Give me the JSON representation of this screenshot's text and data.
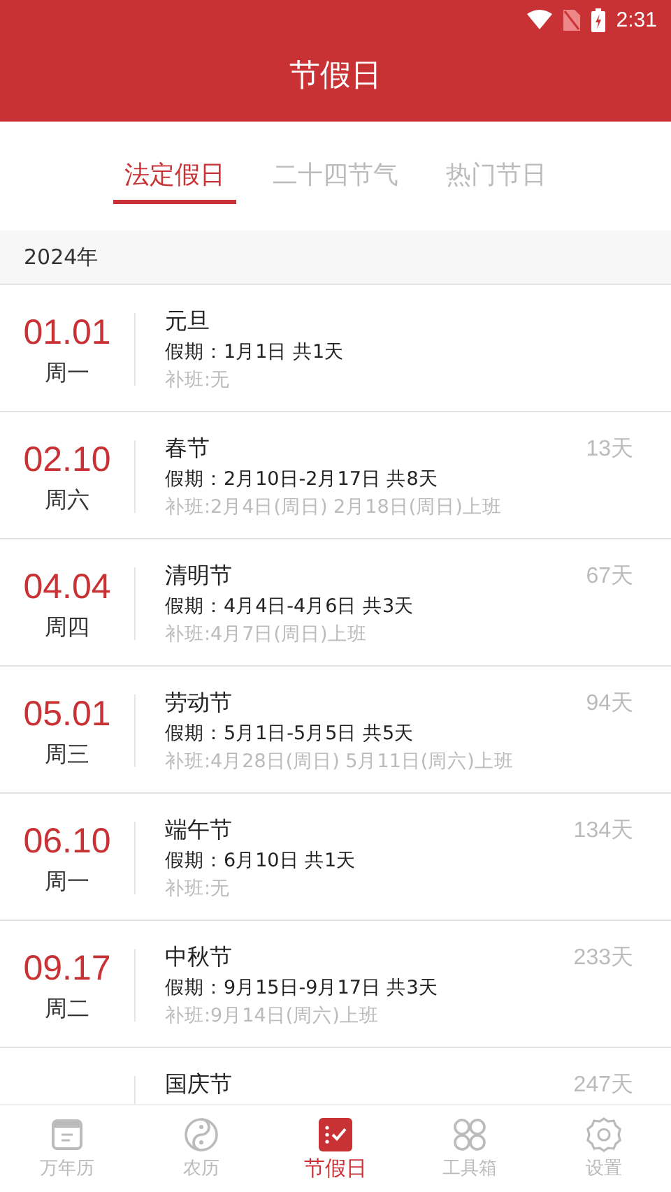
{
  "status_bar": {
    "time": "2:31"
  },
  "header": {
    "title": "节假日"
  },
  "tabs": [
    {
      "label": "法定假日",
      "selected": true
    },
    {
      "label": "二十四节气",
      "selected": false
    },
    {
      "label": "热门节日",
      "selected": false
    }
  ],
  "year": "2024年",
  "holidays": [
    {
      "date": "01.01",
      "weekday": "周一",
      "name": "元旦",
      "period": "假期：1月1日 共1天",
      "makeup": "补班:无"
    },
    {
      "date": "02.10",
      "weekday": "周六",
      "name": "春节",
      "period": "假期：2月10日-2月17日 共8天",
      "makeup": "补班:2月4日(周日) 2月18日(周日)上班",
      "countdown": "13天"
    },
    {
      "date": "04.04",
      "weekday": "周四",
      "name": "清明节",
      "period": "假期：4月4日-4月6日 共3天",
      "makeup": "补班:4月7日(周日)上班",
      "countdown": "67天"
    },
    {
      "date": "05.01",
      "weekday": "周三",
      "name": "劳动节",
      "period": "假期：5月1日-5月5日 共5天",
      "makeup": "补班:4月28日(周日) 5月11日(周六)上班",
      "countdown": "94天"
    },
    {
      "date": "06.10",
      "weekday": "周一",
      "name": "端午节",
      "period": "假期：6月10日 共1天",
      "makeup": "补班:无",
      "countdown": "134天"
    },
    {
      "date": "09.17",
      "weekday": "周二",
      "name": "中秋节",
      "period": "假期：9月15日-9月17日 共3天",
      "makeup": "补班:9月14日(周六)上班",
      "countdown": "233天"
    },
    {
      "name": "国庆节",
      "countdown": "247天"
    }
  ],
  "nav": [
    {
      "kind": "calendar",
      "label": "万年历",
      "selected": false
    },
    {
      "kind": "yinyang",
      "label": "农历",
      "selected": false
    },
    {
      "kind": "holiday",
      "label": "节假日",
      "selected": true
    },
    {
      "kind": "tools",
      "label": "工具箱",
      "selected": false
    },
    {
      "kind": "settings",
      "label": "设置",
      "selected": false
    }
  ]
}
